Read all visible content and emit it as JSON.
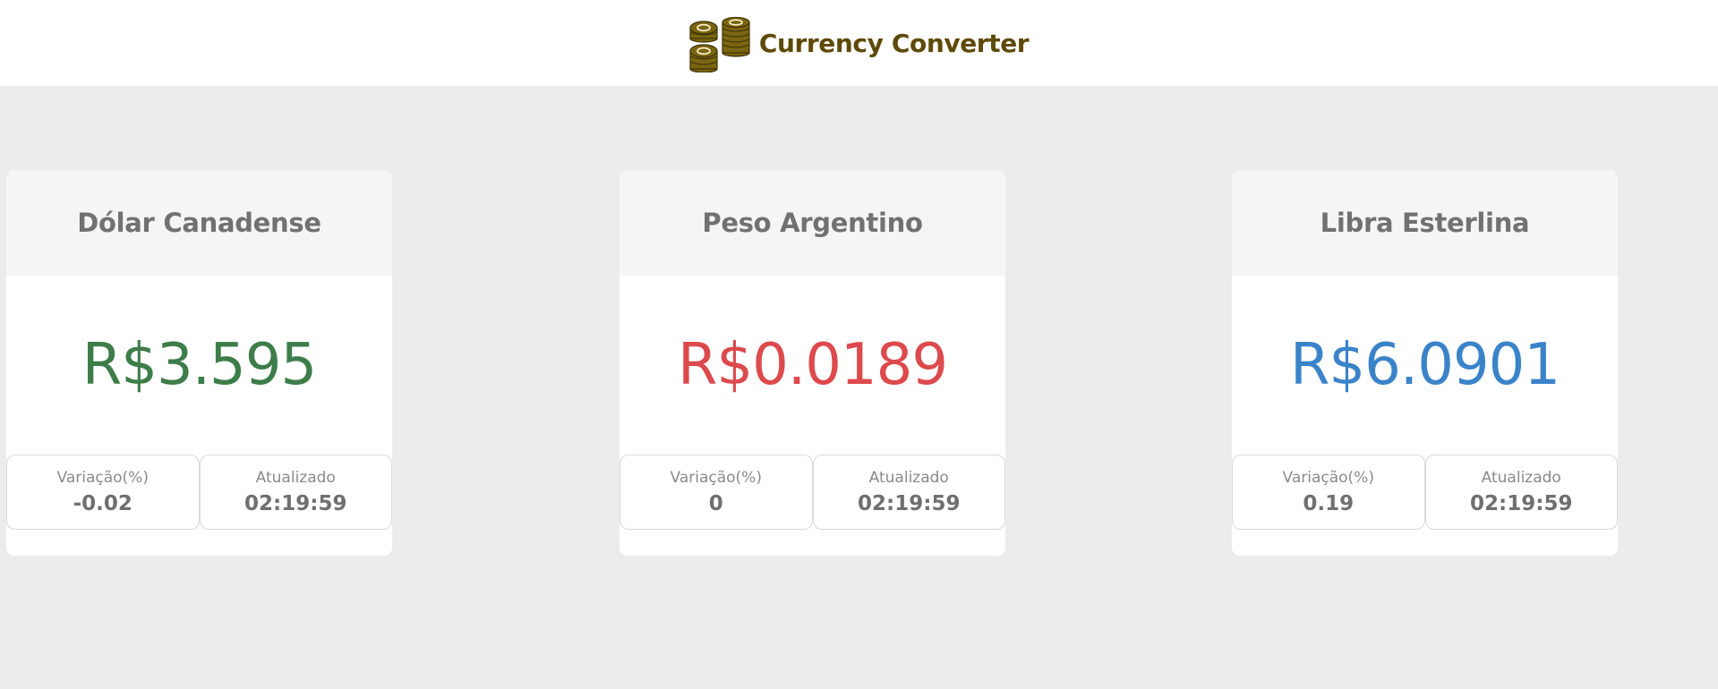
{
  "header": {
    "title": "Currency Converter",
    "logo_icon": "coins-icon",
    "title_color": "#5e4a08"
  },
  "labels": {
    "variation": "Variação(%)",
    "updated": "Atualizado"
  },
  "cards": [
    {
      "title": "Dólar Canadense",
      "rate": "R$3.595",
      "rate_color": "#3d7d4a",
      "variation": "-0.02",
      "updated": "02:19:59"
    },
    {
      "title": "Peso Argentino",
      "rate": "R$0.0189",
      "rate_color": "#dd4a4d",
      "variation": "0",
      "updated": "02:19:59"
    },
    {
      "title": "Libra Esterlina",
      "rate": "R$6.0901",
      "rate_color": "#3b83c9",
      "variation": "0.19",
      "updated": "02:19:59"
    }
  ]
}
